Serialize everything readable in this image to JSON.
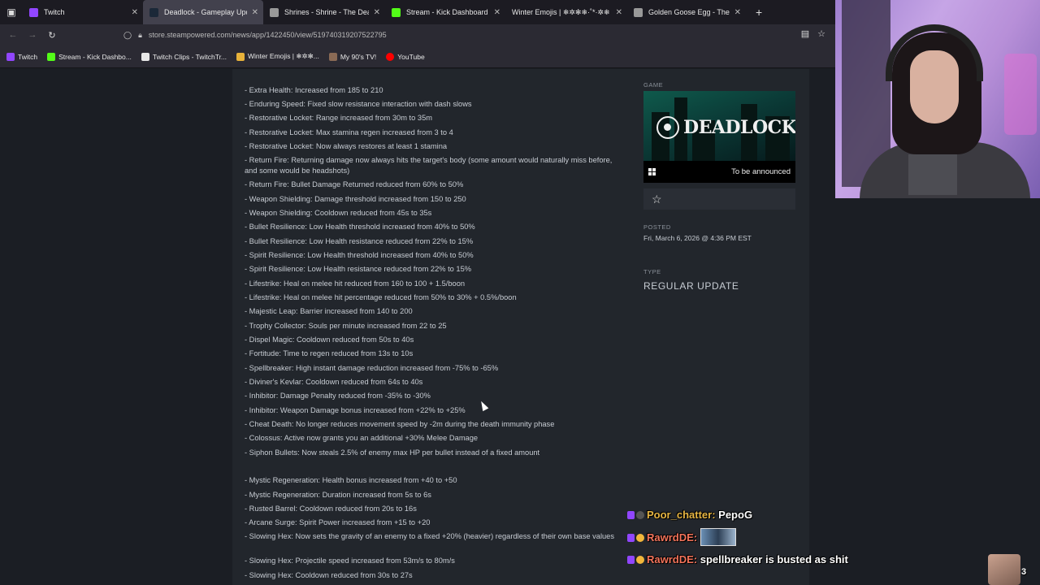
{
  "browser": {
    "tabs": [
      {
        "label": "Twitch",
        "active": false,
        "color": "#9146ff"
      },
      {
        "label": "Deadlock - Gameplay Update - ",
        "active": true,
        "color": "#1b2838"
      },
      {
        "label": "Shrines - Shrine - The Deadlock",
        "active": false,
        "color": "#999999"
      },
      {
        "label": "Stream - Kick Dashboard",
        "active": false,
        "color": "#53fc18"
      },
      {
        "label": "Winter Emojis | ❄✲✻❄·˚*·✲❄",
        "active": false,
        "color": "#2b2a33"
      },
      {
        "label": "Golden Goose Egg - The Deadl",
        "active": false,
        "color": "#999999"
      }
    ],
    "url": "store.steampowered.com/news/app/1422450/view/519740319207522795",
    "bookmarks": [
      {
        "label": "Twitch",
        "color": "#9146ff"
      },
      {
        "label": "Stream - Kick Dashbo...",
        "color": "#53fc18"
      },
      {
        "label": "Twitch Clips - TwitchTr...",
        "color": "#e8e8e8"
      },
      {
        "label": "Winter Emojis | ❄✲✻...",
        "color": "#e8b23a"
      },
      {
        "label": "My 90's TV!",
        "color": "#8a6a55"
      },
      {
        "label": "YouTube",
        "color": "#ff0000"
      }
    ]
  },
  "article": {
    "lines": [
      "- Extra Health: Increased from 185 to 210",
      "- Enduring Speed: Fixed slow resistance interaction with dash slows",
      "- Restorative Locket: Range increased from 30m to 35m",
      "- Restorative Locket: Max stamina regen increased from 3 to 4",
      "- Restorative Locket: Now always restores at least 1 stamina",
      "- Return Fire: Returning damage now always hits the target's body (some amount would naturally miss before, and some would be headshots)",
      "- Return Fire: Bullet Damage Returned reduced from 60% to 50%",
      "- Weapon Shielding: Damage threshold increased from 150 to 250",
      "- Weapon Shielding: Cooldown reduced from 45s to 35s",
      "- Bullet Resilience: Low Health threshold increased from 40% to 50%",
      "- Bullet Resilience: Low Health resistance reduced from 22% to 15%",
      "- Spirit Resilience: Low Health threshold increased from 40% to 50%",
      "- Spirit Resilience: Low Health resistance reduced from 22% to 15%",
      "- Lifestrike: Heal on melee hit reduced from 160 to 100 + 1.5/boon",
      "- Lifestrike: Heal on melee hit percentage reduced from 50% to 30% + 0.5%/boon",
      "- Majestic Leap: Barrier increased from 140 to 200",
      "- Trophy Collector: Souls per minute increased from 22 to 25",
      "- Dispel Magic: Cooldown reduced from 50s to 40s",
      "- Fortitude: Time to regen reduced from 13s to 10s",
      "- Spellbreaker: High instant damage reduction increased from -75% to -65%",
      "- Diviner's Kevlar: Cooldown reduced from 64s to 40s",
      "- Inhibitor: Damage Penalty reduced from -35% to -30%",
      "- Inhibitor: Weapon Damage bonus increased from +22% to +25%",
      "- Cheat Death: No longer reduces movement speed by -2m during the death immunity phase",
      "- Colossus: Active now grants you an additional +30% Melee Damage",
      "- Siphon Bullets: Now steals 2.5% of enemy max HP per bullet instead of a fixed amount",
      "- Mystic Regeneration: Health bonus increased from +40 to +50",
      "- Mystic Regeneration: Duration increased from 5s to 6s",
      "- Rusted Barrel: Cooldown reduced from 20s to 16s",
      "- Arcane Surge: Spirit Power increased from +15 to +20",
      "- Slowing Hex: Now sets the gravity of an enemy to a fixed +20% (heavier) regardless of their own base values",
      "- Slowing Hex: Projectile speed increased from 53m/s to 80m/s",
      "- Slowing Hex: Cooldown reduced from 30s to 27s"
    ]
  },
  "sidebar": {
    "game_label": "GAME",
    "game_name": "DEADLOCK",
    "release": "To be announced",
    "posted_label": "POSTED",
    "posted_date": "Fri, March 6, 2026 @ 4:36 PM EST",
    "type_label": "TYPE",
    "type_value": "REGULAR UPDATE"
  },
  "chat": [
    {
      "user": "Poor_chatter:",
      "text": "PepoG"
    },
    {
      "user": "RawrdDE:",
      "text": ""
    },
    {
      "user": "RawrdDE:",
      "text": "spellbreaker is busted as shit"
    }
  ],
  "overlay": {
    "viewer_count": "3"
  }
}
